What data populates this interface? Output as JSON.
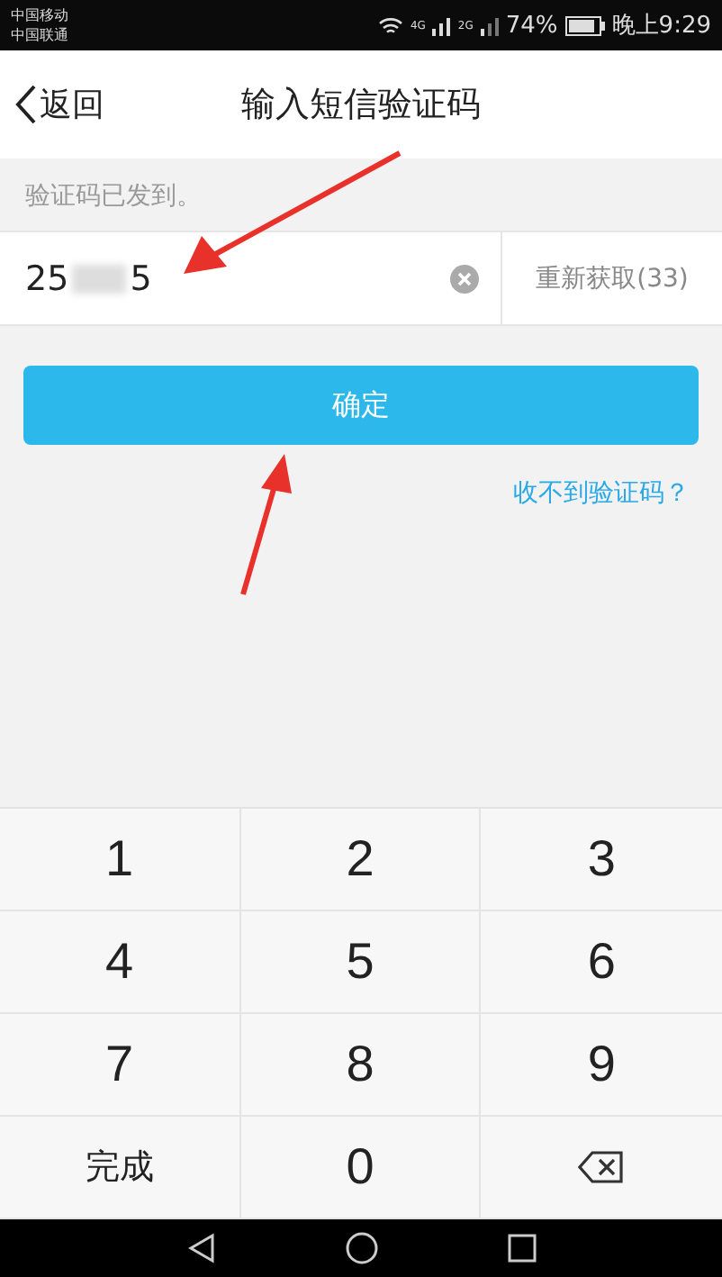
{
  "status_bar": {
    "carriers": [
      "中国移动",
      "中国联通"
    ],
    "network_1": "4G",
    "network_2": "2G",
    "battery": "74%",
    "time": "晚上9:29"
  },
  "header": {
    "back": "返回",
    "title": "输入短信验证码"
  },
  "hint": "验证码已发到。",
  "code_field": {
    "value_start": "25",
    "value_end": "5",
    "resend": "重新获取(33)",
    "resend_disabled": true
  },
  "confirm_button": "确定",
  "help_link": "收不到验证码？",
  "keypad": [
    {
      "kind": "digit",
      "label": "1"
    },
    {
      "kind": "digit",
      "label": "2"
    },
    {
      "kind": "digit",
      "label": "3"
    },
    {
      "kind": "digit",
      "label": "4"
    },
    {
      "kind": "digit",
      "label": "5"
    },
    {
      "kind": "digit",
      "label": "6"
    },
    {
      "kind": "digit",
      "label": "7"
    },
    {
      "kind": "digit",
      "label": "8"
    },
    {
      "kind": "digit",
      "label": "9"
    },
    {
      "kind": "text",
      "label": "完成"
    },
    {
      "kind": "digit",
      "label": "0"
    },
    {
      "kind": "backspace"
    }
  ]
}
